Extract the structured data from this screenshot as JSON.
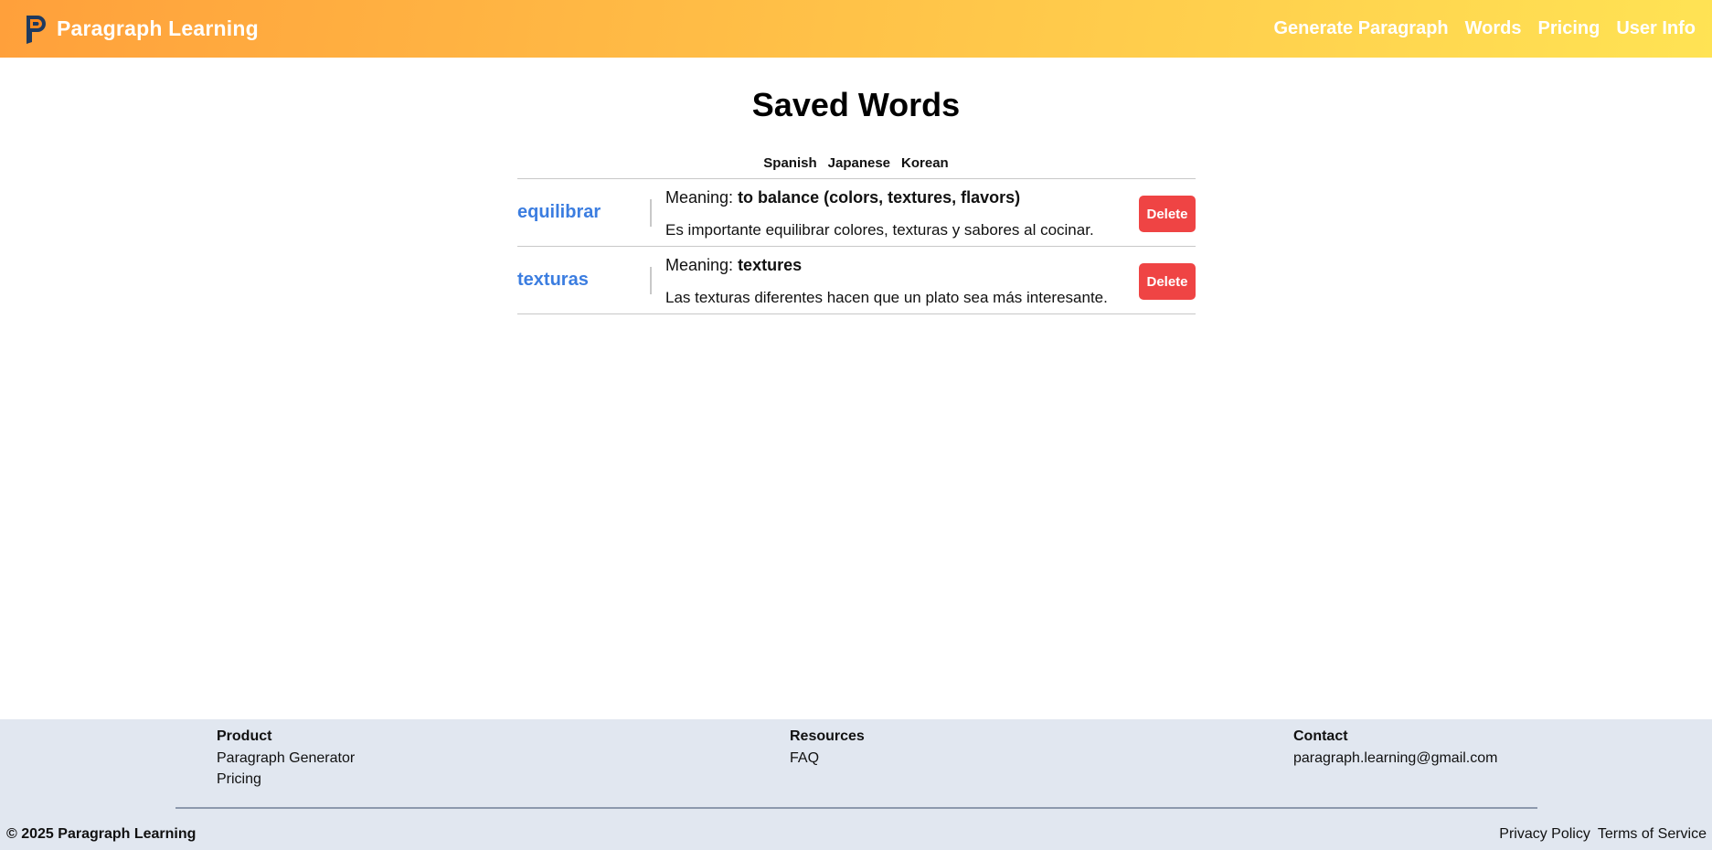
{
  "header": {
    "brand_name": "Paragraph Learning",
    "logo_icon": "paragraph-p-logo-icon",
    "nav": [
      {
        "label": "Generate Paragraph"
      },
      {
        "label": "Words"
      },
      {
        "label": "Pricing"
      },
      {
        "label": "User Info"
      }
    ]
  },
  "main": {
    "title": "Saved Words",
    "language_tabs": [
      "Spanish",
      "Japanese",
      "Korean"
    ],
    "meaning_prefix": "Meaning: ",
    "words": [
      {
        "term": "equilibrar",
        "meaning": "to balance (colors, textures, flavors)",
        "example": "Es importante equilibrar colores, texturas y sabores al cocinar.",
        "delete_label": "Delete"
      },
      {
        "term": "texturas",
        "meaning": "textures",
        "example": "Las texturas diferentes hacen que un plato sea más interesante.",
        "delete_label": "Delete"
      }
    ]
  },
  "footer": {
    "product": {
      "heading": "Product",
      "links": [
        "Paragraph Generator",
        "Pricing"
      ]
    },
    "resources": {
      "heading": "Resources",
      "links": [
        "FAQ"
      ]
    },
    "contact": {
      "heading": "Contact",
      "email": "paragraph.learning@gmail.com"
    },
    "copyright": "© 2025 Paragraph Learning",
    "legal": [
      "Privacy Policy",
      "Terms of Service"
    ]
  },
  "colors": {
    "header_gradient_start": "#ffa03b",
    "header_gradient_end": "#ffe354",
    "word_link": "#3b7de0",
    "delete_button": "#ef4444",
    "footer_background": "#e1e7f0"
  }
}
